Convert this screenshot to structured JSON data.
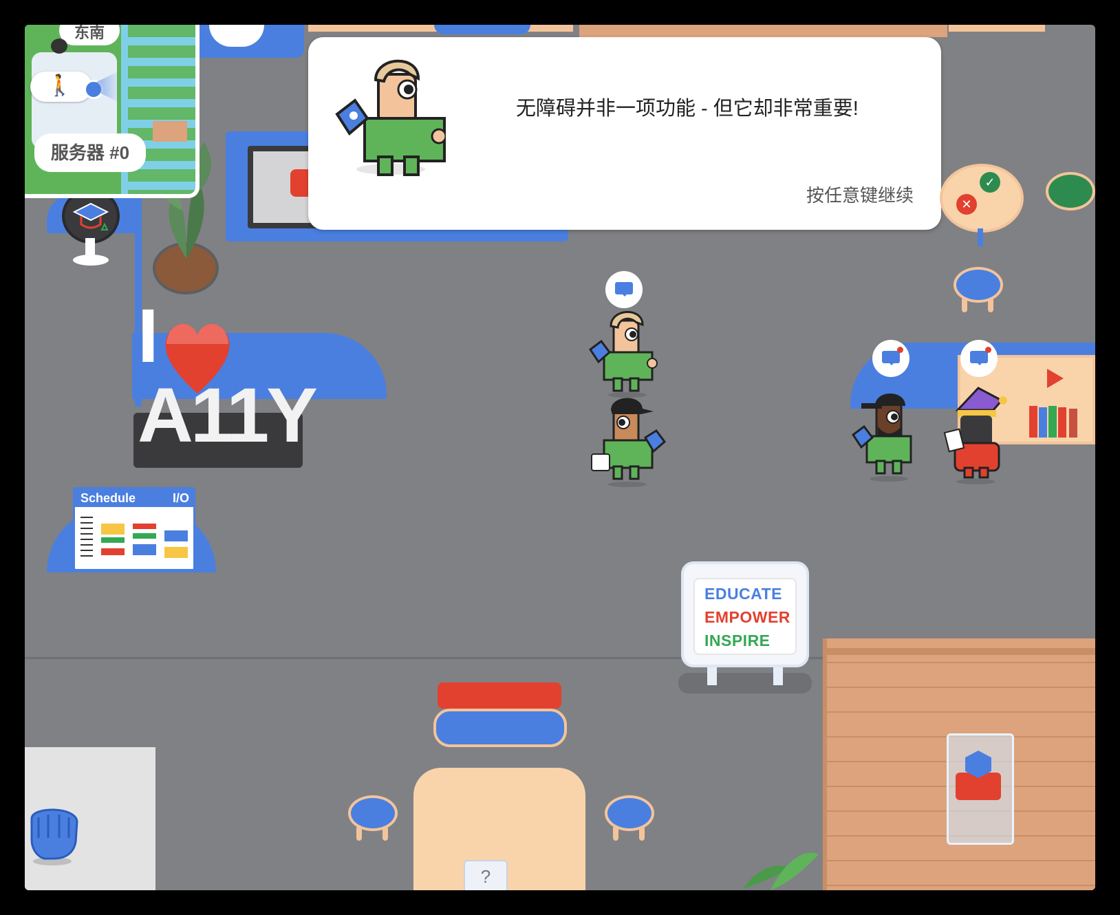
{
  "minimap": {
    "compass_label": "东南",
    "server_label": "服务器 #0"
  },
  "dialog": {
    "message": "无障碍并非一项功能 - 但它却非常重要!",
    "continue_hint": "按任意键继续"
  },
  "a11y_sign": {
    "letter": "I",
    "word": "A11Y"
  },
  "schedule_board": {
    "title": "Schedule",
    "subtitle": "I/O"
  },
  "poster": {
    "line1": "EDUCATE",
    "line2": "EMPOWER",
    "line3": "INSPIRE"
  },
  "question_tile": "?",
  "colors": {
    "floor": "#808184",
    "accent_blue": "#4a7fe0",
    "red": "#e2412f",
    "green": "#34a853",
    "yellow": "#f6c644",
    "wood": "#dca37c"
  }
}
